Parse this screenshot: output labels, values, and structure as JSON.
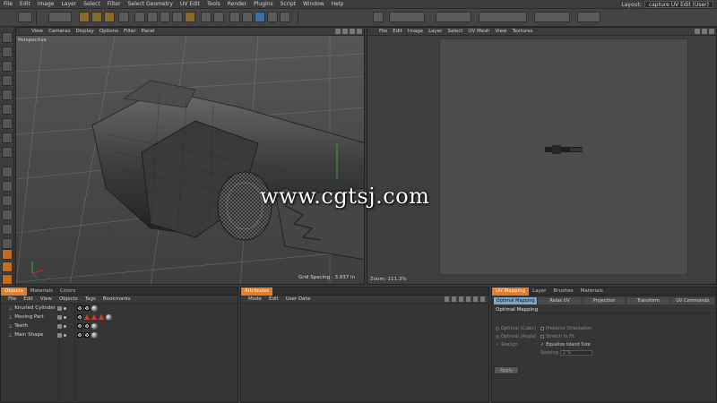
{
  "menubar": {
    "items": [
      "File",
      "Edit",
      "Image",
      "Layer",
      "Select",
      "Filter",
      "Select Geometry",
      "UV Edit",
      "Tools",
      "Render",
      "Plugins",
      "Script",
      "Window",
      "Help"
    ],
    "layout_label": "Layout:",
    "layout_value": "capture UV Edit (User)"
  },
  "viewport": {
    "menu": [
      "View",
      "Cameras",
      "Display",
      "Options",
      "Filter",
      "Panel"
    ],
    "label": "Perspective",
    "grid_spacing": "Grid Spacing : 3.937 in"
  },
  "uv_viewport": {
    "menu": [
      "File",
      "Edit",
      "Image",
      "Layer",
      "Select",
      "UV Mesh",
      "View",
      "Textures"
    ],
    "zoom": "Zoom: 111.3%"
  },
  "watermark": "www.cgtsj.com",
  "objects_panel": {
    "tabs": [
      "Objects",
      "Materials",
      "Colors"
    ],
    "menu": [
      "File",
      "Edit",
      "View",
      "Objects",
      "Tags",
      "Bookmarks"
    ],
    "rows": [
      {
        "name": "Knurled Cylinder"
      },
      {
        "name": "Moving Part"
      },
      {
        "name": "Teeth"
      },
      {
        "name": "Main Shape"
      }
    ]
  },
  "attributes_panel": {
    "tab": "Attributes",
    "menu": [
      "Mode",
      "Edit",
      "User Data"
    ]
  },
  "uv_panel": {
    "tabs": [
      "UV Mapping",
      "Layer",
      "Brushes",
      "Materials"
    ],
    "subtabs": [
      "Optimal Mapping",
      "Relax UV",
      "Projection",
      "Transform",
      "UV Commands"
    ],
    "section_title": "Optimal Mapping",
    "options": {
      "optimal_cubic": "Optimal (Cubic)",
      "optimal_angle": "Optimal (Angle)",
      "realign": "Realign",
      "preserve_orientation": "Preserve Orientation",
      "stretch_to_fit": "Stretch to Fit",
      "equalize_island_size": "Equalize Island Size",
      "spacing_label": "Spacing",
      "spacing_value": "2 %",
      "apply": "Apply"
    }
  },
  "colors": {
    "accent_tab": "#e37d2a",
    "uv_selected_subtab": "#7ea6c8",
    "object_icon": "#5fb3e8"
  }
}
